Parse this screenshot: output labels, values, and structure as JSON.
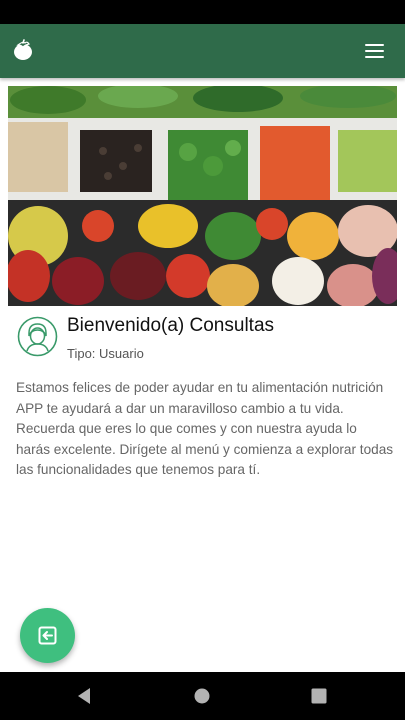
{
  "app": {
    "logo_icon": "tomato-icon",
    "menu_icon": "hamburger-menu-icon",
    "bar_color": "#2f6b4a"
  },
  "hero": {
    "image": "vegetables-salad-bar-photo"
  },
  "profile": {
    "avatar_icon": "user-avatar-icon",
    "welcome": "Bienvenido(a) Consultas",
    "type_label": "Tipo: Usuario"
  },
  "intro": {
    "text": "Estamos felices de poder ayudar en tu alimentación nutrición APP te ayudará a dar un maravilloso cambio a tu vida. Recuerda que eres lo que comes y con nuestra ayuda lo harás excelente. Dirígete al menú y comienza a explorar todas las funcionalidades que tenemos para tí."
  },
  "fab": {
    "icon": "logout-icon",
    "color": "#3fbf7f"
  },
  "system_nav": {
    "back_icon": "back-triangle-icon",
    "home_icon": "home-circle-icon",
    "recents_icon": "recents-square-icon"
  }
}
